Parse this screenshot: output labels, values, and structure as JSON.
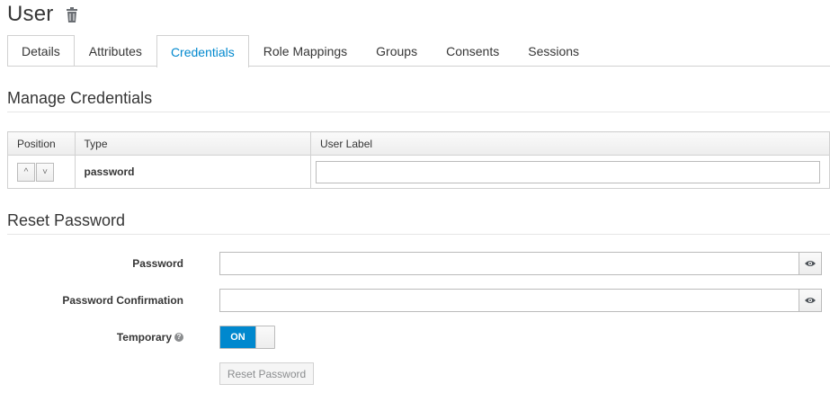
{
  "header": {
    "title": "User",
    "delete_icon": "trash-icon"
  },
  "tabs": [
    {
      "label": "Details",
      "active": false
    },
    {
      "label": "Attributes",
      "active": false
    },
    {
      "label": "Credentials",
      "active": true
    },
    {
      "label": "Role Mappings",
      "active": false
    },
    {
      "label": "Groups",
      "active": false
    },
    {
      "label": "Consents",
      "active": false
    },
    {
      "label": "Sessions",
      "active": false
    }
  ],
  "manage_credentials": {
    "title": "Manage Credentials",
    "columns": [
      "Position",
      "Type",
      "User Label"
    ],
    "rows": [
      {
        "position_up": "^",
        "position_down": "˅",
        "type": "password",
        "user_label": ""
      }
    ]
  },
  "reset_password": {
    "title": "Reset Password",
    "password_label": "Password",
    "password_value": "",
    "confirmation_label": "Password Confirmation",
    "confirmation_value": "",
    "temporary_label": "Temporary",
    "help_icon": "?",
    "temporary_toggle": "ON",
    "reset_button": "Reset Password"
  },
  "colors": {
    "accent": "#0088ce",
    "text": "#363636",
    "border": "#d1d1d1"
  }
}
